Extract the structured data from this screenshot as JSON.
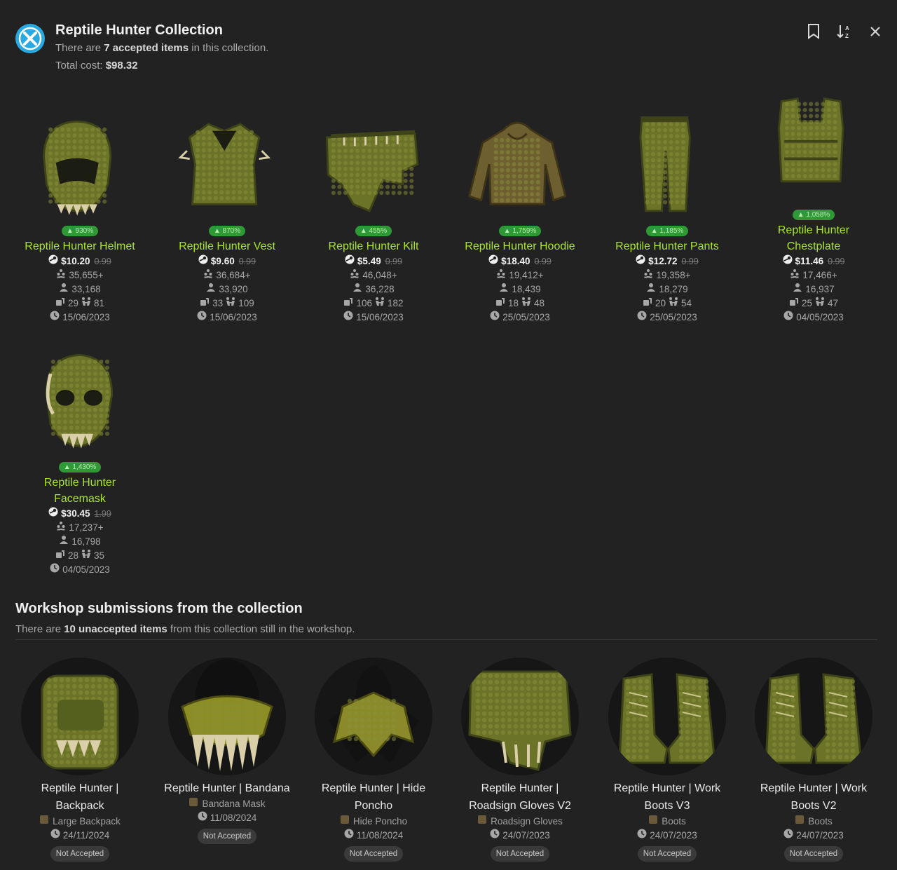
{
  "header": {
    "title": "Reptile Hunter Collection",
    "line1_pre": "There are ",
    "line1_bold": "7 accepted items",
    "line1_post": " in this collection.",
    "line2_pre": "Total cost: ",
    "line2_bold": "$98.32",
    "accent": "#29a9e1"
  },
  "items": [
    {
      "badge": "▲ 930%",
      "name": "Reptile Hunter Helmet",
      "price": "$10.20",
      "old": "0.99",
      "subs": "35,655+",
      "users": "33,168",
      "trades1": "29",
      "trades2": "81",
      "date": "15/06/2023",
      "icon": "helmet"
    },
    {
      "badge": "▲ 870%",
      "name": "Reptile Hunter Vest",
      "price": "$9.60",
      "old": "0.99",
      "subs": "36,684+",
      "users": "33,920",
      "trades1": "33",
      "trades2": "109",
      "date": "15/06/2023",
      "icon": "vest"
    },
    {
      "badge": "▲ 455%",
      "name": "Reptile Hunter Kilt",
      "price": "$5.49",
      "old": "0.99",
      "subs": "46,048+",
      "users": "36,228",
      "trades1": "106",
      "trades2": "182",
      "date": "15/06/2023",
      "icon": "kilt"
    },
    {
      "badge": "▲ 1,759%",
      "name": "Reptile Hunter Hoodie",
      "price": "$18.40",
      "old": "0.99",
      "subs": "19,412+",
      "users": "18,439",
      "trades1": "18",
      "trades2": "48",
      "date": "25/05/2023",
      "icon": "hoodie"
    },
    {
      "badge": "▲ 1,185%",
      "name": "Reptile Hunter Pants",
      "price": "$12.72",
      "old": "0.99",
      "subs": "19,358+",
      "users": "18,279",
      "trades1": "20",
      "trades2": "54",
      "date": "25/05/2023",
      "icon": "pants"
    },
    {
      "badge": "▲ 1,058%",
      "name": "Reptile Hunter Chestplate",
      "price": "$11.46",
      "old": "0.99",
      "subs": "17,466+",
      "users": "16,937",
      "trades1": "25",
      "trades2": "47",
      "date": "04/05/2023",
      "icon": "chestplate"
    },
    {
      "badge": "▲ 1,430%",
      "name": "Reptile Hunter Facemask",
      "price": "$30.45",
      "old": "1.99",
      "subs": "17,237+",
      "users": "16,798",
      "trades1": "28",
      "trades2": "35",
      "date": "04/05/2023",
      "icon": "facemask"
    }
  ],
  "workshop": {
    "title": "Workshop submissions from the collection",
    "sub_pre": "There are ",
    "sub_bold": "10 unaccepted items",
    "sub_post": " from this collection still in the workshop.",
    "entries": [
      {
        "name": "Reptile Hunter | Backpack",
        "type": "Large Backpack",
        "date": "24/11/2024",
        "status": "Not Accepted",
        "icon": "backpack"
      },
      {
        "name": "Reptile Hunter | Bandana",
        "type": "Bandana Mask",
        "date": "11/08/2024",
        "status": "Not Accepted",
        "icon": "bandana"
      },
      {
        "name": "Reptile Hunter | Hide Poncho",
        "type": "Hide Poncho",
        "date": "11/08/2024",
        "status": "Not Accepted",
        "icon": "poncho"
      },
      {
        "name": "Reptile Hunter | Roadsign Gloves V2",
        "type": "Roadsign Gloves",
        "date": "24/07/2023",
        "status": "Not Accepted",
        "icon": "gloves"
      },
      {
        "name": "Reptile Hunter | Work Boots V3",
        "type": "Boots",
        "date": "24/07/2023",
        "status": "Not Accepted",
        "icon": "boots"
      },
      {
        "name": "Reptile Hunter | Work Boots V2",
        "type": "Boots",
        "date": "24/07/2023",
        "status": "Not Accepted",
        "icon": "boots"
      }
    ]
  },
  "colors": {
    "background": "#222223",
    "item_name": "#a8e62a",
    "badge": "#2f9a35",
    "reptile_green": "#5f6a25"
  }
}
